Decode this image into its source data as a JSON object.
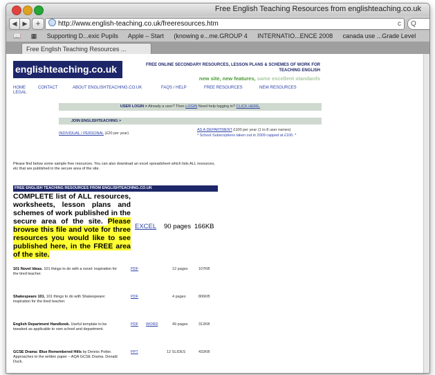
{
  "window": {
    "title": "Free English Teaching Resources from englishteaching.co.uk"
  },
  "toolbar": {
    "back_label": "◀",
    "forward_label": "▶",
    "add_label": "+",
    "url": "http://www.english-teaching.co.uk/freeresources.htm",
    "reload_label": "c",
    "search_label": "Q"
  },
  "bookmarks": {
    "icon_a": "📖",
    "icon_b": "▦",
    "items": [
      "Supporting D...exic Pupils",
      "Apple – Start",
      "(knowing e...me.GROUP 4",
      "INTERNATIO...ENCE 2008",
      "canada use ...Grade Level"
    ]
  },
  "tab": {
    "label": "Free English Teaching Resources ..."
  },
  "site": {
    "logo": "englishteaching.co.uk",
    "header_line1": "FREE ONLINE SECONDARY RESOURCES, LESSON PLANS & SCHEMES OF WORK FOR",
    "header_line2": "TEACHING ENGLISH",
    "tag_new_site": "new site, new features,",
    "tag_same": "same excellent standards",
    "nav": {
      "home": "HOME",
      "legal": "LEGAL",
      "contact": "CONTACT",
      "about": "ABOUT ENGLISHTEACHING.CO.UK",
      "faqs": "FAQS / HELP",
      "free": "FREE RESOURCES",
      "new": "NEW RESOURCES"
    },
    "login": {
      "label": "USER LOGIN >",
      "already": "Already a user? Then",
      "login_link": "LOGIN",
      "help": "Need help logging in?",
      "click_here": "CLICK HERE."
    },
    "join": {
      "label": "JOIN ENGLISHTEACHING >"
    },
    "individual": {
      "link": "INDIVIDUAL / PERSONAL",
      "price": "(£20 per year)"
    },
    "department": {
      "link": "AS A DEPARTMENT",
      "price": "£100 per year (1 to 8 user names)",
      "note": "* School Subscriptions taken out in 2009 capped at £100. *"
    },
    "intro": "Please find below some sample free resources. You can also download an excel spreadsheet which lists ALL resources, etc that are published in the secure area of the site.",
    "section_title": "FREE ENGLISH TEACHING RESOURCES FROM ENGLISHTEACHING.CO.UK",
    "complete_text": "COMPLETE list of ALL resources, worksheets, lesson plans and schemes of work published in the secure area of the site.",
    "complete_highlight": "Please browse this file and vote for three resources you would like to see published here, in the FREE area of the site.",
    "excel": {
      "link": "EXCEL",
      "pages": "90 pages",
      "size": "166KB"
    },
    "resources": [
      {
        "title": "101 Novel Ideas.",
        "desc": "101 things to do with a novel: inspiration for the tired teacher.",
        "link1": "PDF",
        "link2": "",
        "pages": "12 pages",
        "size": "107KB"
      },
      {
        "title": "Shakespeare 101.",
        "desc": "101 things to do with Shakespeare: inspiration for the tired teacher.",
        "link1": "PDF",
        "link2": "",
        "pages": "4 pages",
        "size": "806KB"
      },
      {
        "title": "English Department Handbook.",
        "desc": "Useful template to be tweaked as applicable to own school and department.",
        "link1": "PDF",
        "link2": "WORD",
        "pages": "49 pages",
        "size": "312KB"
      },
      {
        "title": "GCSE Drama: Blue Remembered Hills",
        "desc": "by Dennis Potter. Approaches to the written paper – AQA GCSE Drama. Donald Duck.",
        "link1": "PPT",
        "link2": "",
        "pages": "12 SLIDES",
        "size": "432KB"
      }
    ]
  }
}
